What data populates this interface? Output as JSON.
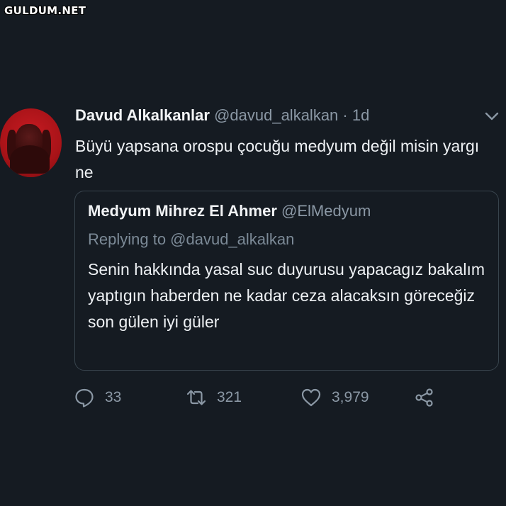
{
  "watermark": "GULDUM.NET",
  "tweet": {
    "author_name": "Davud Alkalkanlar",
    "handle": "@davud_alkalkan",
    "separator": "·",
    "time": "1d",
    "text": "Büyü yapsana orospu çocuğu medyum değil misin yargı ne"
  },
  "quoted_tweet": {
    "author_name": "Medyum Mihrez El Ahmer",
    "handle": "@ElMedyum",
    "replying_to": "Replying to @davud_alkalkan",
    "text": "Senin hakkında yasal suc duyurusu yapacagız bakalım yaptıgın haberden ne kadar ceza alacaksın göreceğiz son gülen iyi güler"
  },
  "actions": {
    "reply_count": "33",
    "retweet_count": "321",
    "like_count": "3,979"
  },
  "icons": {
    "reply": "reply-icon",
    "retweet": "retweet-icon",
    "like": "heart-icon",
    "share": "share-icon",
    "menu": "chevron-down-icon"
  },
  "colors": {
    "background": "#151b22",
    "secondary_text": "#8b98a5",
    "avatar_red": "#c81b22"
  }
}
